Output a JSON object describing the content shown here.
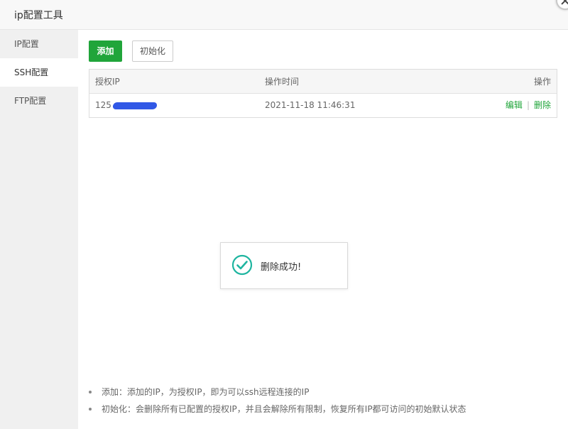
{
  "window": {
    "title": "ip配置工具"
  },
  "sidebar": {
    "items": [
      {
        "label": "IP配置",
        "active": false
      },
      {
        "label": "SSH配置",
        "active": true
      },
      {
        "label": "FTP配置",
        "active": false
      }
    ]
  },
  "toolbar": {
    "add_label": "添加",
    "init_label": "初始化"
  },
  "table": {
    "headers": [
      "授权IP",
      "操作时间",
      "操作"
    ],
    "rows": [
      {
        "ip_prefix": "125",
        "time": "2021-11-18 11:46:31",
        "edit": "编辑",
        "separator": "|",
        "delete": "删除"
      }
    ]
  },
  "toast": {
    "message": "删除成功!"
  },
  "notes": [
    "添加：添加的IP，为授权IP，即为可以ssh远程连接的IP",
    "初始化：会删除所有已配置的授权IP，并且会解除所有限制，恢复所有IP都可访问的初始默认状态"
  ],
  "colors": {
    "accent": "#20a53a",
    "redaction": "#3158e6",
    "toast_check": "#1fb5a0"
  }
}
